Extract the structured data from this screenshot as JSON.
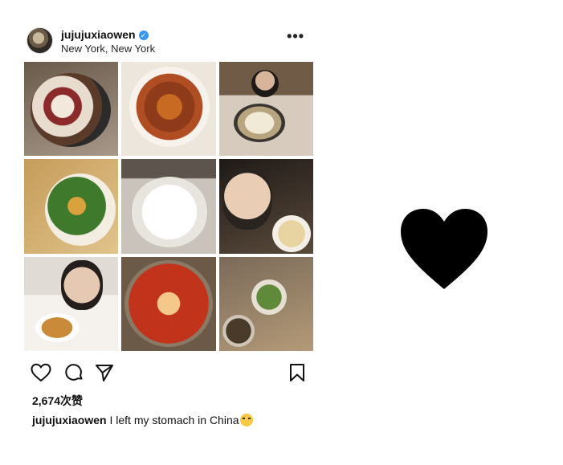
{
  "post": {
    "username": "jujujuxiaowen",
    "location": "New York, New York",
    "verified_glyph": "✓",
    "more_label": "•••",
    "likes": "2,674次赞",
    "caption_user": "jujujuxiaowen",
    "caption_text": "I left my stomach in China",
    "caption_emoji": "crying-cat-emoji"
  },
  "grid": {
    "photos": [
      {
        "subject": "plate of dumplings with chili oil"
      },
      {
        "subject": "bowl of noodles with peanuts and herbs"
      },
      {
        "subject": "person at hot pot table"
      },
      {
        "subject": "noodle soup with greens"
      },
      {
        "subject": "bowl of white rice"
      },
      {
        "subject": "woman with food on spoon"
      },
      {
        "subject": "woman eating noodles"
      },
      {
        "subject": "spicy red hot pot"
      },
      {
        "subject": "table of dishes"
      }
    ]
  },
  "icons": {
    "like": "heart-outline-icon",
    "comment": "comment-bubble-icon",
    "share": "paper-plane-icon",
    "save": "bookmark-icon",
    "big_heart": "heart-filled-icon"
  },
  "colors": {
    "verified_blue": "#3897f0",
    "text": "#111111",
    "heart": "#000000"
  }
}
